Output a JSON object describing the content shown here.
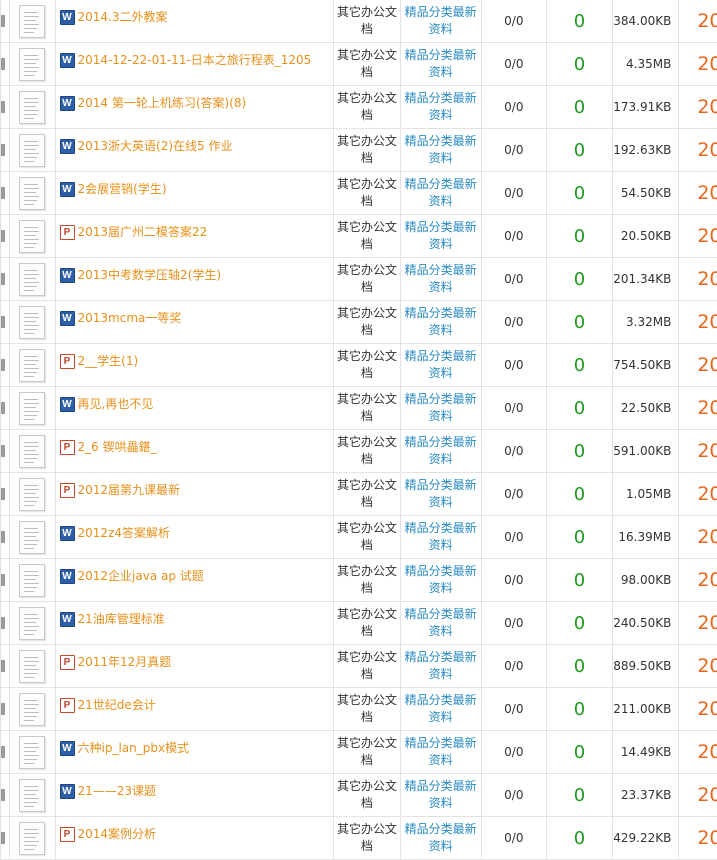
{
  "colors": {
    "title_link": "#e8901a",
    "subcategory_link": "#2a8bc4",
    "download_count": "#1f9a1f",
    "year": "#e8661a",
    "word_icon": "#2d5ea8",
    "ppt_icon": "#c0472a"
  },
  "rows": [
    {
      "type": "word",
      "icon": "W",
      "title": "2014.3二外教案",
      "category": "其它办公文档",
      "subcategory": "精品分类最新资料",
      "ratio": "0/0",
      "count": "0",
      "size": "384.00KB",
      "year": "20"
    },
    {
      "type": "word",
      "icon": "W",
      "title": "2014-12-22-01-11-日本之旅行程表_1205",
      "category": "其它办公文档",
      "subcategory": "精品分类最新资料",
      "ratio": "0/0",
      "count": "0",
      "size": "4.35MB",
      "year": "20"
    },
    {
      "type": "word",
      "icon": "W",
      "title": "2014 第一轮上机练习(答案)(8)",
      "category": "其它办公文档",
      "subcategory": "精品分类最新资料",
      "ratio": "0/0",
      "count": "0",
      "size": "173.91KB",
      "year": "20"
    },
    {
      "type": "word",
      "icon": "W",
      "title": "2013浙大英语(2)在线5 作业",
      "category": "其它办公文档",
      "subcategory": "精品分类最新资料",
      "ratio": "0/0",
      "count": "0",
      "size": "192.63KB",
      "year": "20"
    },
    {
      "type": "word",
      "icon": "W",
      "title": "2会展营销(学生)",
      "category": "其它办公文档",
      "subcategory": "精品分类最新资料",
      "ratio": "0/0",
      "count": "0",
      "size": "54.50KB",
      "year": "20"
    },
    {
      "type": "ppt",
      "icon": "P",
      "title": "2013届广州二模答案22",
      "category": "其它办公文档",
      "subcategory": "精品分类最新资料",
      "ratio": "0/0",
      "count": "0",
      "size": "20.50KB",
      "year": "20"
    },
    {
      "type": "word",
      "icon": "W",
      "title": "2013中考数学压轴2(学生)",
      "category": "其它办公文档",
      "subcategory": "精品分类最新资料",
      "ratio": "0/0",
      "count": "0",
      "size": "201.34KB",
      "year": "20"
    },
    {
      "type": "word",
      "icon": "W",
      "title": "2013mcma一等奖",
      "category": "其它办公文档",
      "subcategory": "精品分类最新资料",
      "ratio": "0/0",
      "count": "0",
      "size": "3.32MB",
      "year": "20"
    },
    {
      "type": "ppt",
      "icon": "P",
      "title": "2__学生(1)",
      "category": "其它办公文档",
      "subcategory": "精品分类最新资料",
      "ratio": "0/0",
      "count": "0",
      "size": "754.50KB",
      "year": "20"
    },
    {
      "type": "word",
      "icon": "W",
      "title": "再见,再也不见",
      "category": "其它办公文档",
      "subcategory": "精品分类最新资料",
      "ratio": "0/0",
      "count": "0",
      "size": "22.50KB",
      "year": "20"
    },
    {
      "type": "ppt",
      "icon": "P",
      "title": "2_6 锲哄畾鍖_",
      "category": "其它办公文档",
      "subcategory": "精品分类最新资料",
      "ratio": "0/0",
      "count": "0",
      "size": "591.00KB",
      "year": "20"
    },
    {
      "type": "ppt",
      "icon": "P",
      "title": "2012届第九课最新",
      "category": "其它办公文档",
      "subcategory": "精品分类最新资料",
      "ratio": "0/0",
      "count": "0",
      "size": "1.05MB",
      "year": "20"
    },
    {
      "type": "word",
      "icon": "W",
      "title": "2012z4答案解析",
      "category": "其它办公文档",
      "subcategory": "精品分类最新资料",
      "ratio": "0/0",
      "count": "0",
      "size": "16.39MB",
      "year": "20"
    },
    {
      "type": "word",
      "icon": "W",
      "title": "2012企业java ap 试题",
      "category": "其它办公文档",
      "subcategory": "精品分类最新资料",
      "ratio": "0/0",
      "count": "0",
      "size": "98.00KB",
      "year": "20"
    },
    {
      "type": "word",
      "icon": "W",
      "title": "21油库管理标准",
      "category": "其它办公文档",
      "subcategory": "精品分类最新资料",
      "ratio": "0/0",
      "count": "0",
      "size": "240.50KB",
      "year": "20"
    },
    {
      "type": "ppt",
      "icon": "P",
      "title": "2011年12月真题",
      "category": "其它办公文档",
      "subcategory": "精品分类最新资料",
      "ratio": "0/0",
      "count": "0",
      "size": "889.50KB",
      "year": "20"
    },
    {
      "type": "ppt",
      "icon": "P",
      "title": "21世纪de会计",
      "category": "其它办公文档",
      "subcategory": "精品分类最新资料",
      "ratio": "0/0",
      "count": "0",
      "size": "211.00KB",
      "year": "20"
    },
    {
      "type": "word",
      "icon": "W",
      "title": "六种ip_lan_pbx模式",
      "category": "其它办公文档",
      "subcategory": "精品分类最新资料",
      "ratio": "0/0",
      "count": "0",
      "size": "14.49KB",
      "year": "20"
    },
    {
      "type": "word",
      "icon": "W",
      "title": "21——23课题",
      "category": "其它办公文档",
      "subcategory": "精品分类最新资料",
      "ratio": "0/0",
      "count": "0",
      "size": "23.37KB",
      "year": "20"
    },
    {
      "type": "ppt",
      "icon": "P",
      "title": "2014案例分析",
      "category": "其它办公文档",
      "subcategory": "精品分类最新资料",
      "ratio": "0/0",
      "count": "0",
      "size": "429.22KB",
      "year": "20"
    }
  ]
}
